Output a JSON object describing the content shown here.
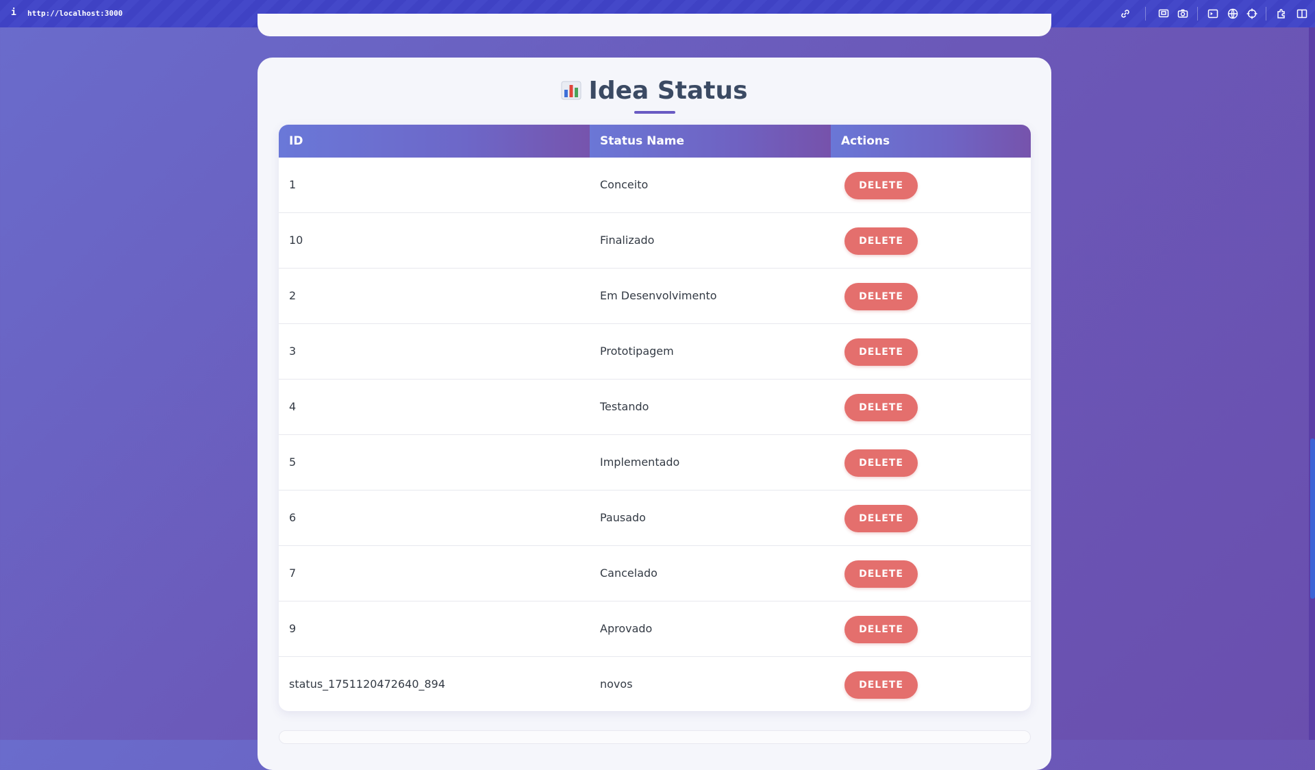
{
  "browser": {
    "info_icon": "i",
    "url": "http://localhost:3000",
    "toolbar_icons": [
      "link-icon",
      "screenshot-icon",
      "camera-icon",
      "terminal-icon",
      "globe-icon",
      "crosshair-icon",
      "extension-icon",
      "sidebar-icon"
    ]
  },
  "section": {
    "title": "Idea Status",
    "title_icon": "bar-chart-icon"
  },
  "table": {
    "headers": {
      "id": "ID",
      "status_name": "Status Name",
      "actions": "Actions"
    },
    "rows": [
      {
        "id": "1",
        "status_name": "Conceito",
        "action": "DELETE"
      },
      {
        "id": "10",
        "status_name": "Finalizado",
        "action": "DELETE"
      },
      {
        "id": "2",
        "status_name": "Em Desenvolvimento",
        "action": "DELETE"
      },
      {
        "id": "3",
        "status_name": "Prototipagem",
        "action": "DELETE"
      },
      {
        "id": "4",
        "status_name": "Testando",
        "action": "DELETE"
      },
      {
        "id": "5",
        "status_name": "Implementado",
        "action": "DELETE"
      },
      {
        "id": "6",
        "status_name": "Pausado",
        "action": "DELETE"
      },
      {
        "id": "7",
        "status_name": "Cancelado",
        "action": "DELETE"
      },
      {
        "id": "9",
        "status_name": "Aprovado",
        "action": "DELETE"
      },
      {
        "id": "status_1751120472640_894",
        "status_name": "novos",
        "action": "DELETE"
      }
    ]
  },
  "colors": {
    "accent": "#6a5bc3",
    "delete_button": "#e46f6d",
    "background_start": "#6a6ccc",
    "background_end": "#6a4fae"
  }
}
